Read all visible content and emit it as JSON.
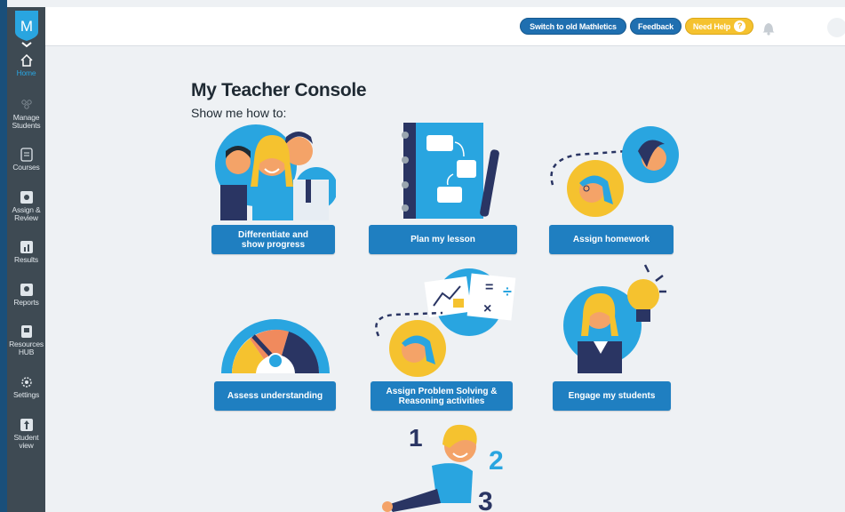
{
  "sidebar": {
    "logo_letter": "M",
    "items": [
      {
        "label": "Home",
        "icon": "home-icon",
        "active": true
      },
      {
        "label": "Manage Students",
        "icon": "students-icon",
        "active": false
      },
      {
        "label": "Courses",
        "icon": "courses-icon",
        "active": false
      },
      {
        "label": "Assign & Review",
        "icon": "assign-icon",
        "active": false
      },
      {
        "label": "Results",
        "icon": "results-icon",
        "active": false
      },
      {
        "label": "Reports",
        "icon": "reports-icon",
        "active": false
      },
      {
        "label": "Resources HUB",
        "icon": "resources-icon",
        "active": false
      },
      {
        "label": "Settings",
        "icon": "settings-icon",
        "active": false
      },
      {
        "label": "Student view",
        "icon": "student-view-icon",
        "active": false
      }
    ]
  },
  "topbar": {
    "switch_label": "Switch to old Mathletics",
    "feedback_label": "Feedback",
    "help_label": "Need Help",
    "help_icon": "?"
  },
  "main": {
    "title": "My Teacher Console",
    "subtitle": "Show me how to:",
    "cards": [
      {
        "label_line1": "Differentiate and",
        "label_line2": "show progress"
      },
      {
        "label_line1": "Plan my lesson",
        "label_line2": ""
      },
      {
        "label_line1": "Assign homework",
        "label_line2": ""
      },
      {
        "label_line1": "Assess understanding",
        "label_line2": ""
      },
      {
        "label_line1": "Assign Problem Solving &",
        "label_line2": "Reasoning activities"
      },
      {
        "label_line1": "Engage my students",
        "label_line2": ""
      }
    ]
  },
  "colors": {
    "sidebar_bg": "#3e4a53",
    "accent_blue": "#1f7fc1",
    "help_yellow": "#f5c22f",
    "active_nav": "#29a5e0"
  }
}
